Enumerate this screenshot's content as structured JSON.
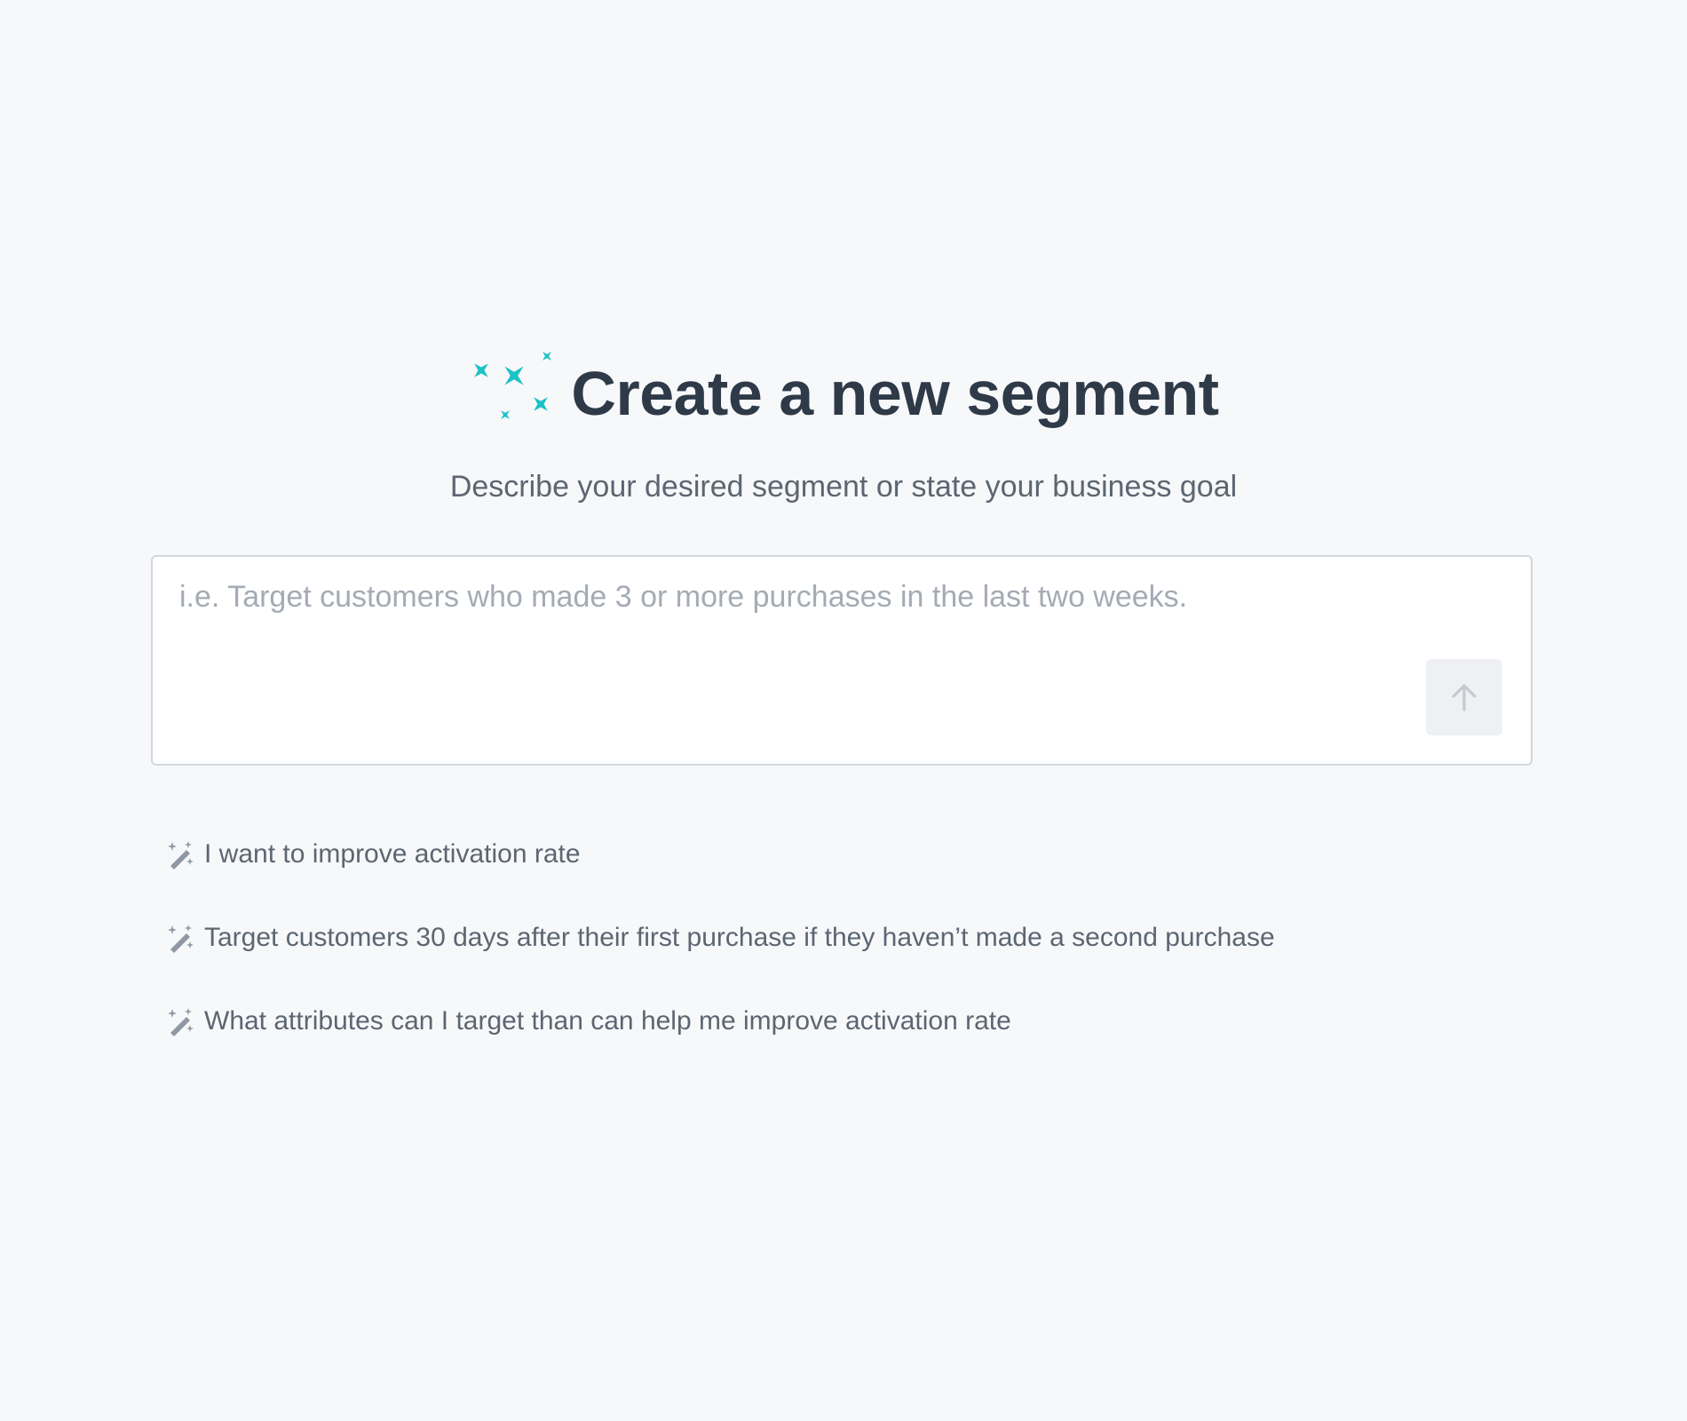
{
  "header": {
    "title": "Create a new segment",
    "subtitle": "Describe your desired segment or state your business goal",
    "icon": "sparkles-icon",
    "accent_color": "#1cc2c6"
  },
  "prompt": {
    "value": "",
    "placeholder": "i.e. Target customers who made 3 or more purchases in the last two weeks.",
    "submit_icon": "arrow-up-icon"
  },
  "suggestions": [
    {
      "icon": "magic-wand-icon",
      "label": "I want to improve activation rate"
    },
    {
      "icon": "magic-wand-icon",
      "label": "Target customers 30 days after their first purchase if they haven’t made a second purchase"
    },
    {
      "icon": "magic-wand-icon",
      "label": "What attributes can I target than can help me improve activation rate"
    }
  ]
}
